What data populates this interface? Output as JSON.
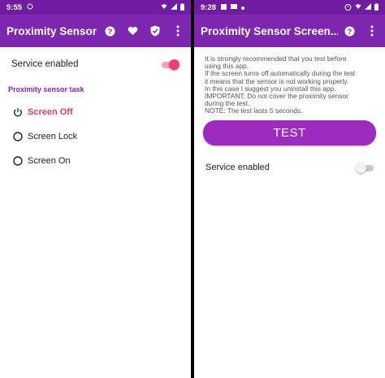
{
  "left": {
    "status": {
      "time": "5:55"
    },
    "app_title": "Proximity Sensor",
    "service_label": "Service enabled",
    "service_enabled": true,
    "section_label": "Proximity sensor task",
    "options": [
      {
        "label": "Screen Off",
        "selected": true,
        "icon": "power-icon"
      },
      {
        "label": "Screen Lock",
        "selected": false,
        "icon": "radio-unchecked-icon"
      },
      {
        "label": "Screen On",
        "selected": false,
        "icon": "radio-unchecked-icon"
      }
    ]
  },
  "right": {
    "status": {
      "time": "9:28"
    },
    "app_title": "Proximity Sensor Screen...",
    "info_lines": [
      "It is strongly recommended that you test before",
      "using this app.",
      "If the screen turns off automatically during the test",
      "it means that the sensor is not working properly.",
      "In this case I suggest you uninstall this app.",
      "IMPORTANT: Do not cover the proximity sensor",
      "during the test.",
      "NOTE: The test lasts 5 seconds."
    ],
    "test_label": "TEST",
    "service_label": "Service enabled",
    "service_enabled": false
  },
  "colors": {
    "status_bar": "#6f1ca0",
    "app_bar": "#7d27b0",
    "accent": "#ee3f74",
    "button": "#9d2bbf"
  }
}
